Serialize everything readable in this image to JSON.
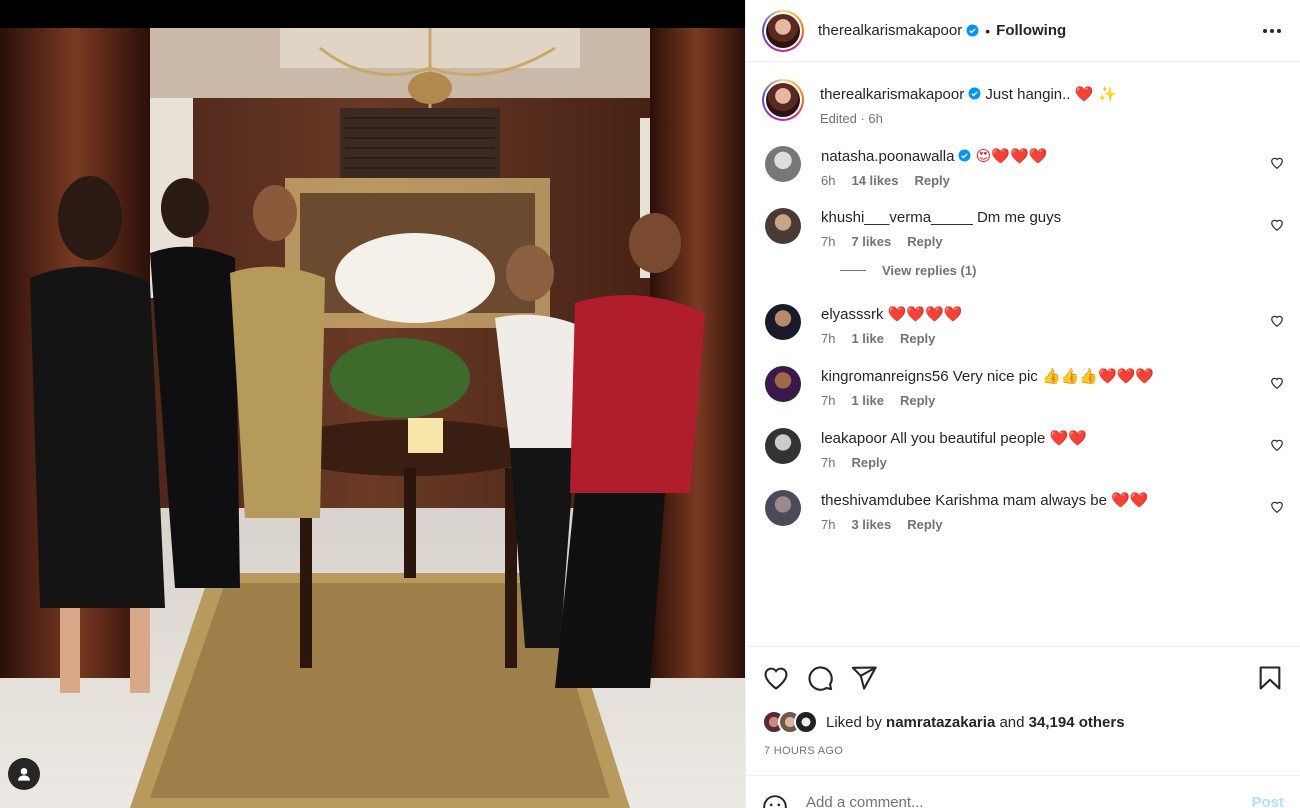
{
  "post": {
    "author": "therealkarismakapoor",
    "follow_status": "Following",
    "separator": "•",
    "caption_text": "Just hangin..",
    "caption_emojis": "❤️ ✨",
    "edited_label": "Edited · 6h"
  },
  "comments": [
    {
      "user": "natasha.poonawalla",
      "verified": true,
      "text": "",
      "emojis": "😍❤️❤️❤️",
      "age": "6h",
      "likes": "14 likes",
      "reply": "Reply"
    },
    {
      "user": "khushi___verma_____",
      "verified": false,
      "text": "Dm me guys",
      "emojis": "",
      "age": "7h",
      "likes": "7 likes",
      "reply": "Reply",
      "view_replies": "View replies (1)"
    },
    {
      "user": "elyasssrk",
      "verified": false,
      "text": "",
      "emojis": "❤️❤️❤️❤️",
      "age": "7h",
      "likes": "1 like",
      "reply": "Reply"
    },
    {
      "user": "kingromanreigns56",
      "verified": false,
      "text": "Very nice pic",
      "emojis": "👍👍👍❤️❤️❤️",
      "age": "7h",
      "likes": "1 like",
      "reply": "Reply"
    },
    {
      "user": "leakapoor",
      "verified": false,
      "text": "All you beautiful people",
      "emojis": "❤️❤️",
      "age": "7h",
      "likes": "",
      "reply": "Reply"
    },
    {
      "user": "theshivamdubee",
      "verified": false,
      "text": "Karishma mam always be",
      "emojis": "❤️❤️",
      "age": "7h",
      "likes": "3 likes",
      "reply": "Reply"
    }
  ],
  "likes": {
    "prefix": "Liked by",
    "liker": "namratazakaria",
    "joiner": "and",
    "others": "34,194 others"
  },
  "timestamp": "7 HOURS AGO",
  "add_comment": {
    "placeholder": "Add a comment...",
    "post_label": "Post"
  },
  "icons": {
    "like": "heart-icon",
    "comment": "comment-icon",
    "share": "share-icon",
    "save": "bookmark-icon",
    "more": "more-options-icon",
    "tag": "user-tag-icon",
    "emoji": "emoji-icon"
  },
  "colors": {
    "verified_blue": "#0095f6",
    "heart_red": "#ed1c24",
    "post_button_disabled": "#b2dffc"
  }
}
